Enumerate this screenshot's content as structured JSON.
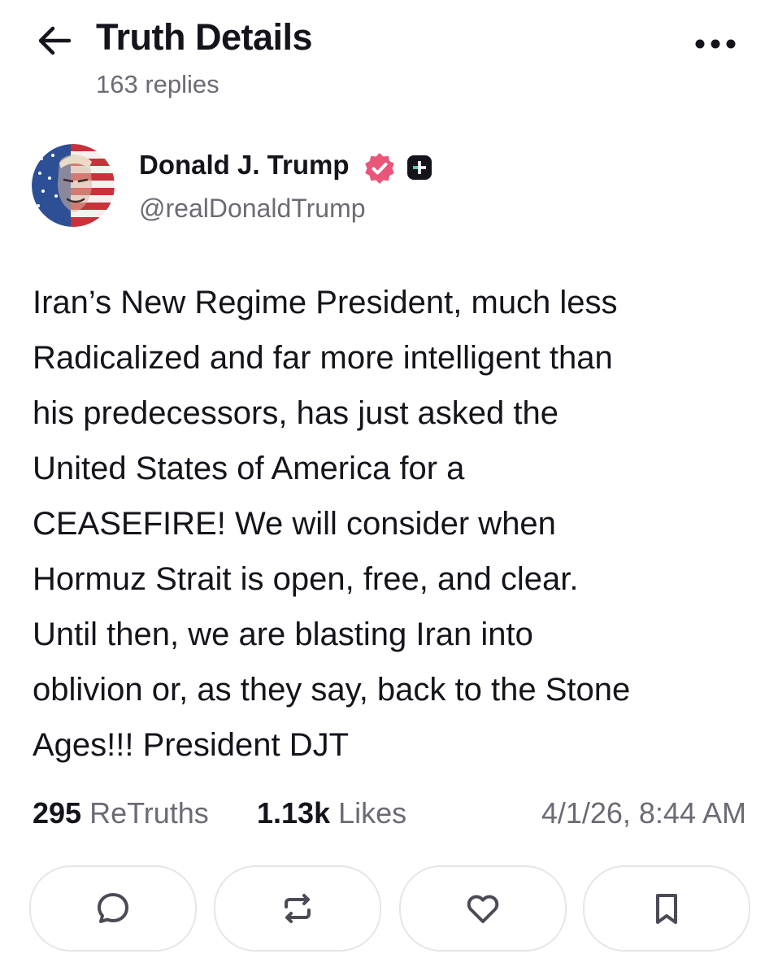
{
  "header": {
    "title": "Truth Details",
    "subtitle": "163 replies",
    "back_icon": "arrow-left-icon",
    "more_icon": "more-horizontal-icon"
  },
  "author": {
    "display_name": "Donald J. Trump",
    "handle": "@realDonaldTrump",
    "verified_badge_color": "#e8577a",
    "plus_badge_color": "#14141c",
    "plus_badge_accent": "#3cd6b4"
  },
  "post": {
    "lines": [
      "Iran’s New Regime President, much less",
      "Radicalized and far more intelligent than",
      "his predecessors, has just asked the",
      "United States of America for a",
      "CEASEFIRE! We will consider when",
      "Hormuz Strait is open, free, and clear.",
      "Until then, we are blasting Iran into",
      "oblivion or, as they say, back to the Stone",
      "Ages!!! President DJT"
    ]
  },
  "stats": {
    "retruths_count": "295",
    "retruths_label": "ReTruths",
    "likes_count": "1.13k",
    "likes_label": "Likes",
    "timestamp": "4/1/26, 8:44 AM"
  },
  "actions": [
    {
      "name": "reply",
      "icon": "comment-icon"
    },
    {
      "name": "retruth",
      "icon": "repost-icon"
    },
    {
      "name": "like",
      "icon": "heart-icon"
    },
    {
      "name": "bookmark",
      "icon": "bookmark-icon"
    }
  ]
}
